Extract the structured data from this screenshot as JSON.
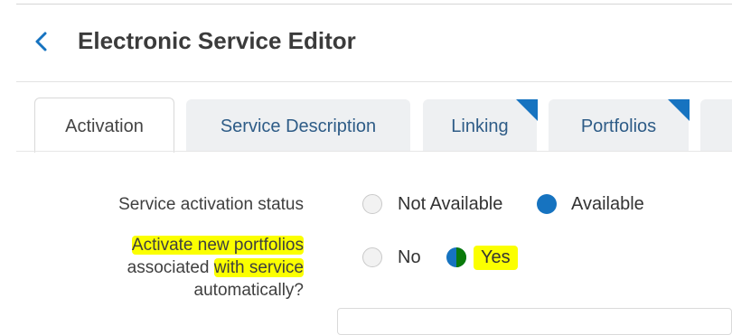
{
  "header": {
    "title": "Electronic Service Editor"
  },
  "tabs": [
    {
      "label": "Activation",
      "active": true
    },
    {
      "label": "Service Description",
      "active": false
    },
    {
      "label": "Linking",
      "active": false,
      "corner_marker": true
    },
    {
      "label": "Portfolios",
      "active": false,
      "corner_marker": true
    }
  ],
  "form": {
    "activation_status": {
      "label": "Service activation status",
      "options": [
        "Not Available",
        "Available"
      ],
      "selected": "Available"
    },
    "auto_activate": {
      "label_line1": "Activate new portfolios",
      "label_line2_pre": "associated ",
      "label_line2_hl": "with service",
      "label_line3": "automatically?",
      "options": [
        "No",
        "Yes"
      ],
      "selected": "Yes"
    }
  },
  "colors": {
    "accent": "#1673c0",
    "tab_text": "#2e5c87",
    "highlight": "#fbff00",
    "selected_green": "#0a7a0a"
  }
}
